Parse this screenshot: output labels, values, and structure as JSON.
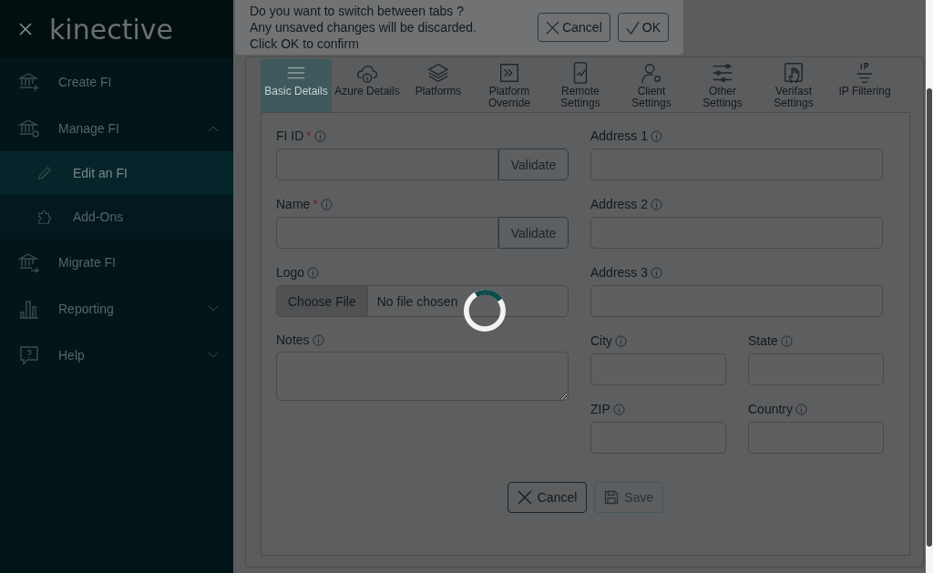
{
  "sidebar": {
    "logo": "kinective",
    "items": [
      {
        "label": "Create FI"
      },
      {
        "label": "Manage FI",
        "expanded": true,
        "children": [
          {
            "label": "Edit an FI",
            "selected": true
          },
          {
            "label": "Add-Ons",
            "selected": false
          }
        ]
      },
      {
        "label": "Migrate FI"
      },
      {
        "label": "Reporting",
        "expanded": false
      },
      {
        "label": "Help",
        "expanded": false
      }
    ]
  },
  "tabs": [
    {
      "label": "Basic Details",
      "selected": true
    },
    {
      "label": "Azure Details",
      "selected": false
    },
    {
      "label": "Platforms",
      "selected": false
    },
    {
      "label": "Platform Override",
      "selected": false
    },
    {
      "label": "Remote Settings",
      "selected": false
    },
    {
      "label": "Client Settings",
      "selected": false
    },
    {
      "label": "Other Settings",
      "selected": false
    },
    {
      "label": "Verifast Settings",
      "selected": false
    },
    {
      "label": "IP Filtering",
      "selected": false
    }
  ],
  "dialog": {
    "lines": [
      "Do you want to switch between tabs ?",
      "Any unsaved changes will be discarded.",
      "Click OK to confirm"
    ],
    "cancel": "Cancel",
    "ok": "OK"
  },
  "form": {
    "left": [
      {
        "kind": "validate",
        "label": "FI ID",
        "marker": "*",
        "button": "Validate"
      },
      {
        "kind": "validate",
        "label": "Name",
        "marker": "*",
        "button": "Validate"
      },
      {
        "kind": "file",
        "label": "Logo",
        "button": "Choose File",
        "status": "No file chosen"
      },
      {
        "kind": "textarea",
        "label": "Notes"
      }
    ],
    "right": [
      {
        "label": "Address 1"
      },
      {
        "label": "Address 2"
      },
      {
        "label": "Address 3"
      }
    ],
    "pairs": [
      {
        "label": "City"
      },
      {
        "label": "State"
      },
      {
        "label": "ZIP"
      },
      {
        "label": "Country"
      }
    ],
    "cancel": "Cancel",
    "save": "Save",
    "save_disabled": true
  },
  "loading": true
}
